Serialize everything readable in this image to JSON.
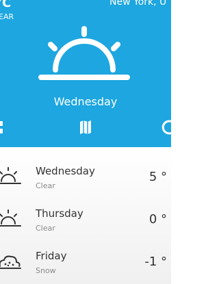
{
  "header": {
    "temperature_partial": "°C",
    "condition": "EAR",
    "location": "New York, U",
    "hero_day": "Wednesday"
  },
  "toolbar": {
    "left_icon": "grid-icon",
    "center_icon": "map-icon",
    "right_icon": "refresh-icon"
  },
  "forecast": [
    {
      "day": "Wednesday",
      "condition": "Clear",
      "temp": "5 °",
      "icon": "sunrise-icon"
    },
    {
      "day": "Thursday",
      "condition": "Clear",
      "temp": "0 °",
      "icon": "sunrise-icon"
    },
    {
      "day": "Friday",
      "condition": "Snow",
      "temp": "-1 °",
      "icon": "snow-cloud-icon"
    }
  ],
  "colors": {
    "header": "#1da6e0",
    "text_dark": "#333333",
    "text_light": "#8a8a8a"
  }
}
